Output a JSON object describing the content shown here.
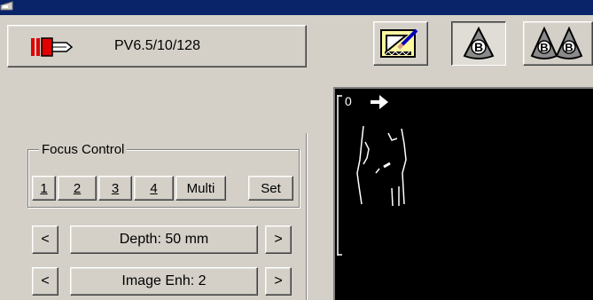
{
  "window": {
    "app_icon": "ultrasound-app-icon"
  },
  "probe": {
    "label": "PV6.5/10/128",
    "icon": "probe-icon"
  },
  "toolbar": {
    "icons": [
      "annotation-pencil-icon",
      "b-mode-icon",
      "dual-b-mode-icon"
    ],
    "b_mode_active": true
  },
  "focus_control": {
    "title": "Focus Control",
    "buttons": [
      {
        "label": "1"
      },
      {
        "label": "2"
      },
      {
        "label": "3"
      },
      {
        "label": "4"
      },
      {
        "label": "Multi"
      },
      {
        "label": "Set"
      }
    ]
  },
  "depth": {
    "label": "Depth: 50 mm",
    "left": "<",
    "right": ">"
  },
  "image_enh": {
    "label": "Image Enh: 2",
    "left": "<",
    "right": ">"
  },
  "image": {
    "depth_start": "0",
    "orientation_icon": "right-arrow-icon"
  },
  "colors": {
    "title_bar": "#0a246a",
    "face": "#d4d0c8",
    "image_bg": "#000000",
    "probe_red": "#e00000"
  }
}
